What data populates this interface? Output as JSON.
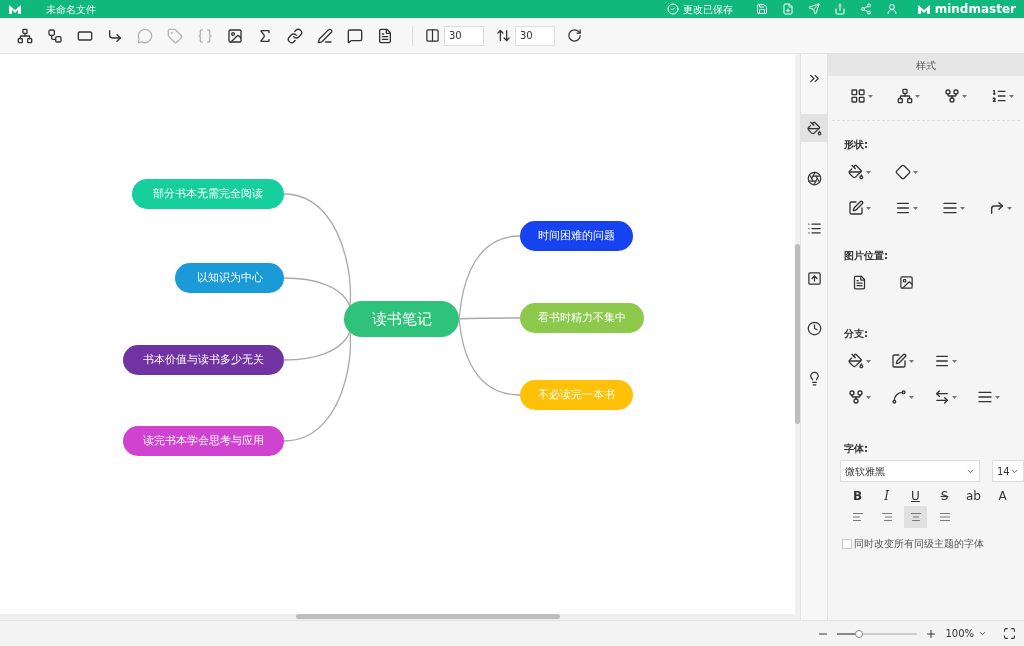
{
  "title_bar": {
    "file_name": "未命名文件",
    "save_status": "更改已保存",
    "brand": "mindmaster"
  },
  "toolbar": {
    "tools": [
      {
        "disabled": false
      },
      {
        "disabled": false
      },
      {
        "disabled": false
      },
      {
        "disabled": false
      },
      {
        "disabled": true
      },
      {
        "disabled": true
      },
      {
        "disabled": true
      },
      {
        "disabled": false
      },
      {
        "disabled": false
      },
      {
        "disabled": false
      },
      {
        "disabled": false
      },
      {
        "disabled": false
      },
      {
        "disabled": false
      }
    ],
    "horizontal_spacing": "30",
    "vertical_spacing": "30"
  },
  "mind_map": {
    "central": {
      "text": "读书笔记",
      "color": "#2ec27a"
    },
    "left_topics": [
      {
        "text": "部分书本无需完全阅读",
        "color": "#17cf9c"
      },
      {
        "text": "以知识为中心",
        "color": "#1a9bd7"
      },
      {
        "text": "书本价值与读书多少无关",
        "color": "#7132a2"
      },
      {
        "text": "读完书本学会思考与应用",
        "color": "#d042d0"
      }
    ],
    "right_topics": [
      {
        "text": "时间困难的问题",
        "color": "#1642f0"
      },
      {
        "text": "看书时精力不集中",
        "color": "#8cc94c"
      },
      {
        "text": "不必读完一本书",
        "color": "#ffc107"
      }
    ]
  },
  "side_rail": [
    {
      "selected": false
    },
    {
      "selected": true
    },
    {
      "selected": false
    },
    {
      "selected": false
    },
    {
      "selected": false
    },
    {
      "selected": false
    },
    {
      "selected": false
    }
  ],
  "panel": {
    "tab": "样式",
    "shape_label": "形状:",
    "image_position_label": "图片位置:",
    "branch_label": "分支:",
    "font_label": "字体:",
    "font_family": "微软雅黑",
    "font_size": "14",
    "text_styles": [
      "B",
      "I",
      "U",
      "S",
      "ab",
      "A"
    ],
    "alignments": [
      {
        "selected": false
      },
      {
        "selected": false
      },
      {
        "selected": true
      },
      {
        "selected": false
      }
    ],
    "sync_font": {
      "label": "同时改变所有同级主题的字体",
      "checked": false
    }
  },
  "status_bar": {
    "zoom": {
      "level": 0.27
    },
    "zoom_text": "100%"
  }
}
